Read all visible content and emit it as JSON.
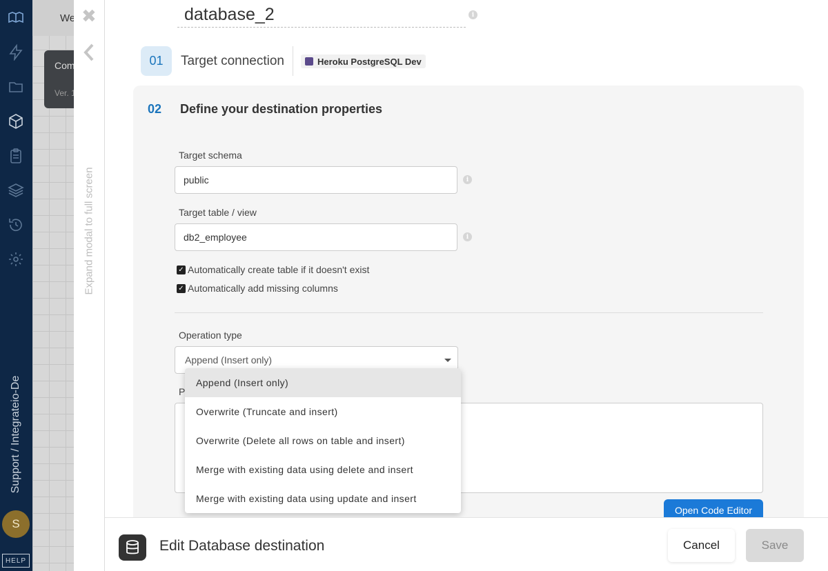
{
  "nav": {
    "vertical_text": "Support / Integrateio-De",
    "avatar_initial": "S",
    "help_label": "HELP",
    "icons": [
      "logo-icon",
      "lightning-icon",
      "folder-icon",
      "package-icon",
      "clipboard-icon",
      "layers-icon",
      "history-icon",
      "settings-icon"
    ]
  },
  "background": {
    "topbar_text": "We",
    "card_title": "Com",
    "card_sub": "Ver. 1"
  },
  "strip": {
    "close_glyph": "✖",
    "expand_text": "Expand modal to full screen"
  },
  "modal": {
    "component_name": "database_2",
    "step1": {
      "number": "01",
      "label": "Target connection",
      "connection_name": "Heroku PostgreSQL Dev"
    },
    "step2": {
      "number": "02",
      "label": "Define your destination properties"
    },
    "target_schema": {
      "label": "Target schema",
      "value": "public"
    },
    "target_table": {
      "label": "Target table / view",
      "value": "db2_employee"
    },
    "checkboxes": [
      {
        "label": "Automatically create table if it doesn't exist",
        "checked": true
      },
      {
        "label": "Automatically add missing columns",
        "checked": true
      }
    ],
    "operation_type": {
      "label": "Operation type",
      "selected": "Append (Insert only)",
      "options": [
        "Append (Insert only)",
        "Overwrite (Truncate and insert)",
        "Overwrite (Delete all rows on table and insert)",
        "Merge with existing data using delete and insert",
        "Merge with existing data using update and insert"
      ]
    },
    "partial_label": "P",
    "open_code_editor": "Open Code Editor"
  },
  "footer": {
    "title": "Edit Database destination",
    "cancel": "Cancel",
    "save": "Save"
  },
  "colors": {
    "nav_bg": "#0e2746",
    "accent": "#1b75bc",
    "button_blue": "#1b7ad8"
  }
}
